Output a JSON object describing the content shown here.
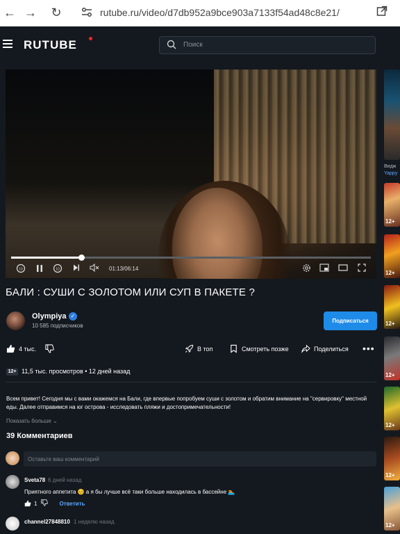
{
  "browser": {
    "url": "rutube.ru/video/d7db952a9bce903a7133f54ad48c8e21/"
  },
  "header": {
    "logo": "RUTUBE",
    "search_placeholder": "Поиск"
  },
  "player": {
    "current_time": "01:13",
    "duration": "06:14",
    "progress_fraction": 0.195
  },
  "video": {
    "title": "БАЛИ : СУШИ С ЗОЛОТОМ ИЛИ СУП В ПАКЕТЕ ?",
    "channel": "Olympiya",
    "subscribers": "10 585 подписчиков",
    "subscribe_label": "Подписаться",
    "likes": "4 тыс.",
    "actions": {
      "top": "В топ",
      "watch_later": "Смотреть позже",
      "share": "Поделиться"
    },
    "age_rating": "12+",
    "views": "11,5 тыс. просмотров",
    "published": "12 дней назад",
    "description": "Всем привет! Сегодня мы с вами окажемся на Бали, где впервые попробуем суши с золотом и обратим внимание на \"сервировку\" местной еды. Далее отправимся на юг острова - исследовать пляжи и достопримечательности!",
    "show_more": "Показать больше"
  },
  "comments": {
    "count_label": "39 Комментариев",
    "input_placeholder": "Оставьте ваш комментарий",
    "items": [
      {
        "author": "Sveta78",
        "time": "6 дней назад",
        "text": "Приятного аппетита 😊 а я бы лучше всё таки больше находилась в бассейне 🏊",
        "likes": "1",
        "reply_label": "Ответить"
      },
      {
        "author": "channel27848810",
        "time": "1 неделю назад",
        "text": ""
      }
    ]
  },
  "sidebar": {
    "first_title": "Видж",
    "first_channel": "Yappy",
    "age_rating": "12+"
  },
  "colors": {
    "background": "#14191f",
    "accent": "#1f8be8",
    "link": "#5aa7ff"
  }
}
